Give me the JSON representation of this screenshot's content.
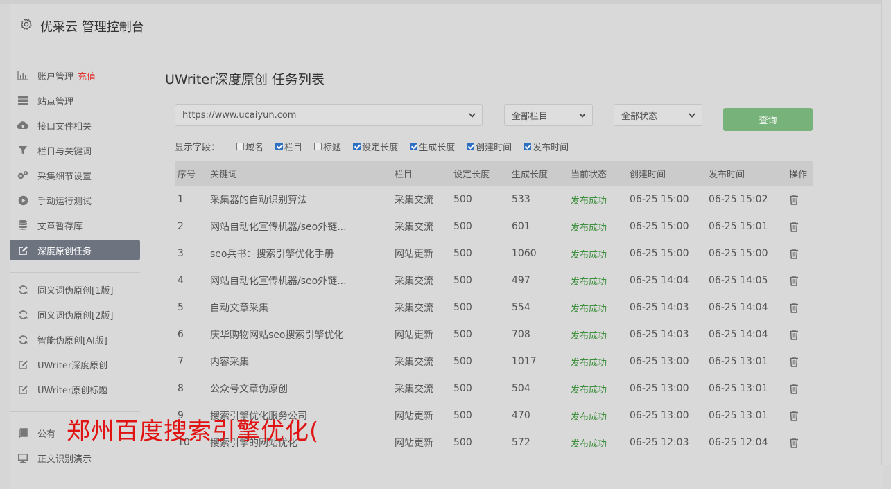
{
  "header": {
    "title": "优采云 管理控制台",
    "icon": "gear-icon"
  },
  "sidebar": {
    "group1": [
      {
        "label": "账户管理",
        "badge": "充值",
        "icon": "bar-chart-icon"
      },
      {
        "label": "站点管理",
        "icon": "server-icon"
      },
      {
        "label": "接口文件相关",
        "icon": "cloud-upload-icon"
      },
      {
        "label": "栏目与关键词",
        "icon": "filter-icon"
      },
      {
        "label": "采集细节设置",
        "icon": "cogs-icon"
      },
      {
        "label": "手动运行测试",
        "icon": "play-icon"
      },
      {
        "label": "文章暂存库",
        "icon": "database-icon"
      },
      {
        "label": "深度原创任务",
        "icon": "edit-icon",
        "active": true
      }
    ],
    "group2": [
      {
        "label": "同义词伪原创[1版]",
        "icon": "refresh-icon"
      },
      {
        "label": "同义词伪原创[2版]",
        "icon": "refresh-icon"
      },
      {
        "label": "智能伪原创[AI版]",
        "icon": "refresh-icon"
      },
      {
        "label": "UWriter深度原创",
        "icon": "edit-icon"
      },
      {
        "label": "UWriter原创标题",
        "icon": "edit-icon"
      }
    ],
    "group3": [
      {
        "label": "公有",
        "icon": "book-icon"
      },
      {
        "label": "正文识别演示",
        "icon": "monitor-icon"
      }
    ]
  },
  "main": {
    "title": "UWriter深度原创 任务列表",
    "filters": {
      "site": "https://www.ucaiyun.com",
      "column": "全部栏目",
      "status": "全部状态",
      "query_button": "查询"
    },
    "fields_label": "显示字段：",
    "fields": [
      {
        "label": "域名",
        "checked": false
      },
      {
        "label": "栏目",
        "checked": true
      },
      {
        "label": "标题",
        "checked": false
      },
      {
        "label": "设定长度",
        "checked": true
      },
      {
        "label": "生成长度",
        "checked": true
      },
      {
        "label": "创建时间",
        "checked": true
      },
      {
        "label": "发布时间",
        "checked": true
      }
    ],
    "table": {
      "headers": [
        "序号",
        "关键词",
        "栏目",
        "设定长度",
        "生成长度",
        "当前状态",
        "创建时间",
        "发布时间",
        "操作"
      ],
      "rows": [
        [
          "1",
          "采集器的自动识别算法",
          "采集交流",
          "500",
          "533",
          "发布成功",
          "06-25 15:00",
          "06-25 15:02"
        ],
        [
          "2",
          "网站自动化宣传机器/seo外链...",
          "采集交流",
          "500",
          "601",
          "发布成功",
          "06-25 15:00",
          "06-25 15:01"
        ],
        [
          "3",
          "seo兵书：搜索引擎优化手册",
          "网站更新",
          "500",
          "1060",
          "发布成功",
          "06-25 15:00",
          "06-25 15:00"
        ],
        [
          "4",
          "网站自动化宣传机器/seo外链...",
          "采集交流",
          "500",
          "497",
          "发布成功",
          "06-25 14:04",
          "06-25 14:05"
        ],
        [
          "5",
          "自动文章采集",
          "采集交流",
          "500",
          "554",
          "发布成功",
          "06-25 14:03",
          "06-25 14:04"
        ],
        [
          "6",
          "庆华购物网站seo搜索引擎优化",
          "网站更新",
          "500",
          "708",
          "发布成功",
          "06-25 14:03",
          "06-25 14:04"
        ],
        [
          "7",
          "内容采集",
          "采集交流",
          "500",
          "1017",
          "发布成功",
          "06-25 13:00",
          "06-25 13:01"
        ],
        [
          "8",
          "公众号文章伪原创",
          "采集交流",
          "500",
          "504",
          "发布成功",
          "06-25 13:00",
          "06-25 13:01"
        ],
        [
          "9",
          "搜索引擎优化服务公司",
          "网站更新",
          "500",
          "470",
          "发布成功",
          "06-25 13:00",
          "06-25 13:01"
        ],
        [
          "10",
          "搜索引擎的网站优化",
          "网站更新",
          "500",
          "572",
          "发布成功",
          "06-25 12:03",
          "06-25 12:04"
        ]
      ]
    }
  },
  "overlay": {
    "watermark": "郑州百度搜索引擎优化("
  },
  "colors": {
    "active_bg": "#6e7380",
    "query_btn": "#78b27b",
    "status_ok": "#3c8f3c",
    "recharge": "#e03b3b",
    "watermark": "#e01212"
  }
}
